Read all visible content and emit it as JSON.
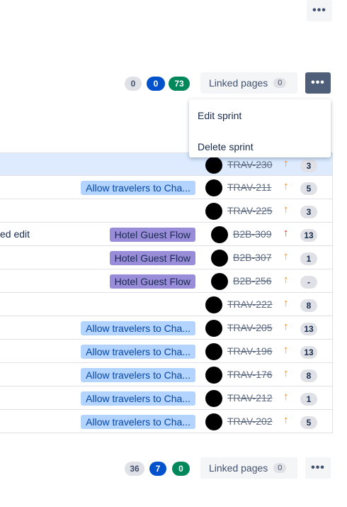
{
  "top": {
    "more_icon": "more-horizontal-icon",
    "more_label": "•••"
  },
  "sprint_header": {
    "counts": {
      "todo": "0",
      "in_progress": "0",
      "done": "73"
    },
    "linked_pages_label": "Linked pages",
    "linked_pages_count": "0",
    "more_label": "•••"
  },
  "menu": {
    "items": [
      "Edit sprint",
      "Delete sprint"
    ]
  },
  "rows": [
    {
      "text": "",
      "epic": "",
      "epic_style": "",
      "key": "TRAV-230",
      "priority": "medium",
      "priority_glyph": "↑",
      "estimate": "3",
      "selected": true
    },
    {
      "text": "",
      "epic": "Allow travelers to Cha...",
      "epic_style": "light",
      "key": "TRAV-211",
      "priority": "medium",
      "priority_glyph": "↑",
      "estimate": "5"
    },
    {
      "text": "",
      "epic": "",
      "epic_style": "",
      "key": "TRAV-225",
      "priority": "medium",
      "priority_glyph": "↑",
      "estimate": "3"
    },
    {
      "text": "ed edit",
      "epic": "Hotel Guest Flow",
      "epic_style": "purple",
      "key": "B2B-309",
      "priority": "high",
      "priority_glyph": "↑",
      "estimate": "13"
    },
    {
      "text": "",
      "epic": "Hotel Guest Flow",
      "epic_style": "purple",
      "key": "B2B-307",
      "priority": "medium",
      "priority_glyph": "↑",
      "estimate": "1"
    },
    {
      "text": "",
      "epic": "Hotel Guest Flow",
      "epic_style": "purple",
      "key": "B2B-256",
      "priority": "medium",
      "priority_glyph": "↑",
      "estimate": "-"
    },
    {
      "text": "",
      "epic": "",
      "epic_style": "",
      "key": "TRAV-222",
      "priority": "medium",
      "priority_glyph": "↑",
      "estimate": "8"
    },
    {
      "text": "",
      "epic": "Allow travelers to Cha...",
      "epic_style": "light",
      "key": "TRAV-205",
      "priority": "medium",
      "priority_glyph": "↑",
      "estimate": "13"
    },
    {
      "text": "",
      "epic": "Allow travelers to Cha...",
      "epic_style": "light",
      "key": "TRAV-196",
      "priority": "medium",
      "priority_glyph": "↑",
      "estimate": "13"
    },
    {
      "text": "",
      "epic": "Allow travelers to Cha...",
      "epic_style": "light",
      "key": "TRAV-176",
      "priority": "medium",
      "priority_glyph": "↑",
      "estimate": "8"
    },
    {
      "text": "",
      "epic": "Allow travelers to Cha...",
      "epic_style": "light",
      "key": "TRAV-212",
      "priority": "medium",
      "priority_glyph": "↑",
      "estimate": "1"
    },
    {
      "text": "",
      "epic": "Allow travelers to Cha...",
      "epic_style": "light",
      "key": "TRAV-202",
      "priority": "medium",
      "priority_glyph": "↑",
      "estimate": "5"
    }
  ],
  "backlog_header": {
    "counts": {
      "todo": "36",
      "in_progress": "7",
      "done": "0"
    },
    "linked_pages_label": "Linked pages",
    "linked_pages_count": "0",
    "more_label": "•••"
  },
  "colors": {
    "priority_medium": "#ff8b00",
    "priority_high": "#de350b",
    "epic_light": "#b3d4ff",
    "epic_purple": "#998dd9"
  }
}
